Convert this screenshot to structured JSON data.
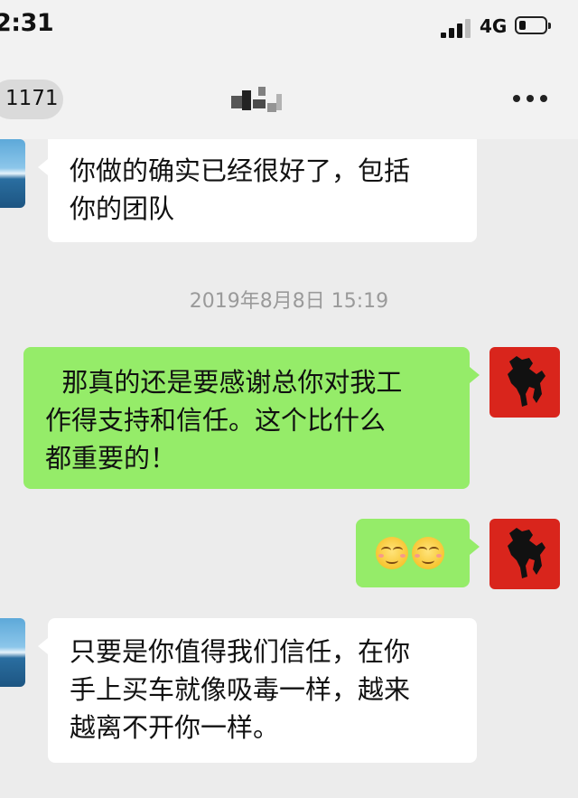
{
  "status_bar": {
    "time": "2:31",
    "network": "4G",
    "battery_level": 0.2
  },
  "nav": {
    "unread_count": "1171"
  },
  "chat": {
    "timestamp": "2019年8月8日 15:19",
    "messages": [
      {
        "side": "in",
        "lines": [
          "你做的确实已经很好了，包括",
          "你的团队"
        ]
      },
      {
        "side": "out",
        "lines": [
          "  那真的还是要感谢总你对我工",
          "作得支持和信任。这个比什么",
          "都重要的！"
        ]
      },
      {
        "side": "out",
        "emoji": [
          "smiling-face-icon",
          "smiling-face-icon"
        ]
      },
      {
        "side": "in",
        "lines": [
          "只要是你值得我们信任，在你",
          "手上买车就像吸毒一样，越来",
          "越离不开你一样。"
        ]
      }
    ]
  },
  "colors": {
    "background": "#ececec",
    "incoming_bubble": "#ffffff",
    "outgoing_bubble": "#95ec69",
    "avatar_red": "#d9251c"
  }
}
